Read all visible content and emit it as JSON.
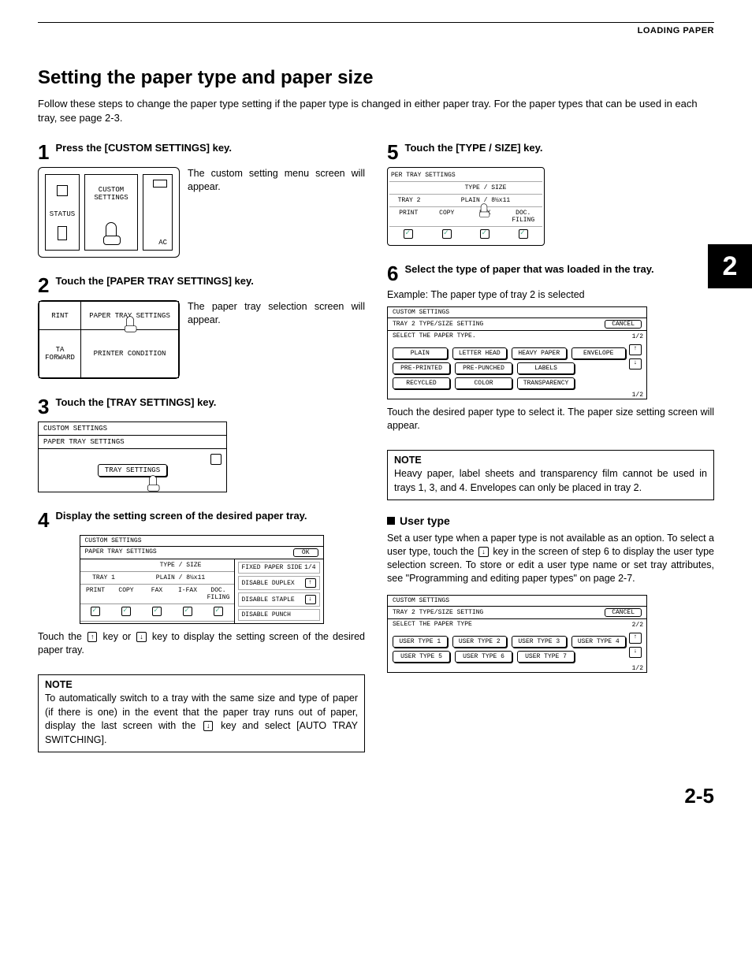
{
  "header": {
    "running": "LOADING PAPER"
  },
  "title": "Setting the paper type and paper size",
  "intro": "Follow these steps to change the paper type setting if the paper type is changed in either paper tray. For the paper types that can be used in each tray, see page 2-3.",
  "chapter_tab": "2",
  "page_number": "2-5",
  "steps": {
    "s1": {
      "num": "1",
      "title": "Press the [CUSTOM SETTINGS] key.",
      "text": "The custom setting menu screen will appear.",
      "panel": {
        "status": "STATUS",
        "label": "CUSTOM SETTINGS",
        "ac": "AC"
      }
    },
    "s2": {
      "num": "2",
      "title": "Touch the [PAPER TRAY SETTINGS] key.",
      "text": "The paper tray selection screen will appear.",
      "panel": {
        "a": "RINT",
        "b": "PAPER TRAY SETTINGS",
        "c": "TA FORWARD",
        "d": "PRINTER CONDITION"
      }
    },
    "s3": {
      "num": "3",
      "title": "Touch the [TRAY SETTINGS] key.",
      "panel": {
        "h1": "CUSTOM SETTINGS",
        "h2": "PAPER TRAY SETTINGS",
        "btn": "TRAY SETTINGS"
      }
    },
    "s4": {
      "num": "4",
      "title": "Display the setting screen of the desired paper tray.",
      "panel": {
        "h1": "CUSTOM SETTINGS",
        "h2": "PAPER TRAY SETTINGS",
        "ok": "OK",
        "type_size": "TYPE / SIZE",
        "tray": "TRAY 1",
        "val": "PLAIN / 8½x11",
        "cols": [
          "PRINT",
          "COPY",
          "FAX",
          "I-FAX",
          "DOC. FILING"
        ],
        "opts": [
          "FIXED PAPER SIDE",
          "DISABLE DUPLEX",
          "DISABLE STAPLE",
          "DISABLE PUNCH"
        ],
        "page": "1/4"
      },
      "after1": "Touch the ",
      "after2": " key or ",
      "after3": " key to display the setting screen of the desired paper tray.",
      "up": "↑",
      "down": "↓"
    },
    "s5": {
      "num": "5",
      "title": "Touch the [TYPE / SIZE] key.",
      "panel": {
        "h": "PER TRAY SETTINGS",
        "type_size": "TYPE / SIZE",
        "tray": "TRAY 2",
        "val": "PLAIN / 8½x11",
        "cols": [
          "PRINT",
          "COPY",
          "FAX",
          "DOC. FILING"
        ]
      }
    },
    "s6": {
      "num": "6",
      "title": "Select the type of paper that was loaded in the tray.",
      "example": "Example: The paper type of tray 2 is selected",
      "panel": {
        "h1": "CUSTOM SETTINGS",
        "h2": "TRAY 2 TYPE/SIZE SETTING",
        "cancel": "CANCEL",
        "prompt": "SELECT THE PAPER TYPE.",
        "page": "1/2",
        "rows": [
          [
            "PLAIN",
            "LETTER HEAD",
            "HEAVY PAPER",
            "ENVELOPE"
          ],
          [
            "PRE-PRINTED",
            "PRE-PUNCHED",
            "LABELS",
            ""
          ],
          [
            "RECYCLED",
            "COLOR",
            "TRANSPARENCY",
            ""
          ]
        ],
        "footer_page": "1/2"
      },
      "after": "Touch the desired paper type to select it. The paper size setting screen will appear."
    }
  },
  "notes": {
    "n4": {
      "label": "NOTE",
      "body1": "To automatically switch to a tray with the same size and type of paper (if there is one) in the event that the paper tray runs out of paper, display the last screen with the ",
      "body2": " key and select [AUTO TRAY SWITCHING].",
      "down": "↓"
    },
    "n6": {
      "label": "NOTE",
      "body": "Heavy paper, label sheets and transparency film cannot be used in trays 1, 3, and 4. Envelopes can only be placed in tray 2."
    }
  },
  "usertype": {
    "heading": "User type",
    "body1": "Set a user type when a paper type is not available as an option. To select a user type, touch the ",
    "body2": " key in the screen of step 6 to display the user type selection screen. To store or edit a user type name or set tray attributes, see \"Programming and editing paper types\" on page 2-7.",
    "down": "↓",
    "panel": {
      "h1": "CUSTOM SETTINGS",
      "h2": "TRAY 2 TYPE/SIZE SETTING",
      "cancel": "CANCEL",
      "prompt": "SELECT THE PAPER TYPE",
      "page": "2/2",
      "rows": [
        [
          "USER TYPE 1",
          "USER TYPE 2",
          "USER TYPE 3",
          "USER TYPE 4"
        ],
        [
          "USER TYPE 5",
          "USER TYPE 6",
          "USER TYPE 7",
          ""
        ]
      ],
      "footer_page": "1/2"
    }
  }
}
